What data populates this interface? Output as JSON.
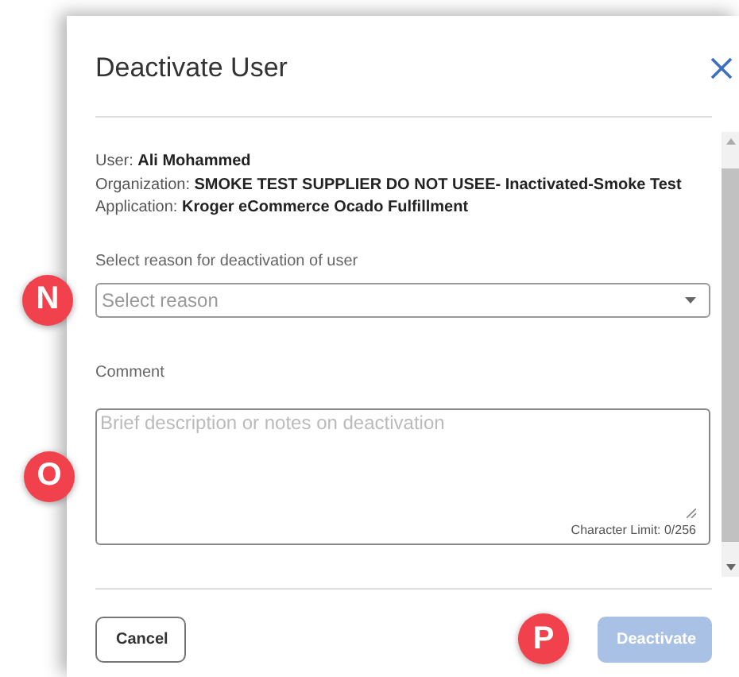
{
  "dialog": {
    "title": "Deactivate User",
    "details": [
      "User: **Ali Mohammed**",
      "Organization: **SMOKE TEST SUPPLIER DO NOT USEE- Inactivated-Smoke Test**",
      "Application: **Kroger eCommerce Ocado Fulfillment**"
    ],
    "reason": {
      "label": "Select reason for deactivation of user",
      "placeholder": "Select reason",
      "marker": "N"
    },
    "comment": {
      "label": "Comment",
      "placeholder": "Brief description or notes on deactivation",
      "counter": "Character Limit: 0/256",
      "marker": "O"
    },
    "buttons": [
      {
        "label": "Cancel",
        "kind": "secondary",
        "disabled": false
      },
      {
        "label": "Deactivate",
        "kind": "primary",
        "disabled": true,
        "marker": "P"
      }
    ]
  }
}
